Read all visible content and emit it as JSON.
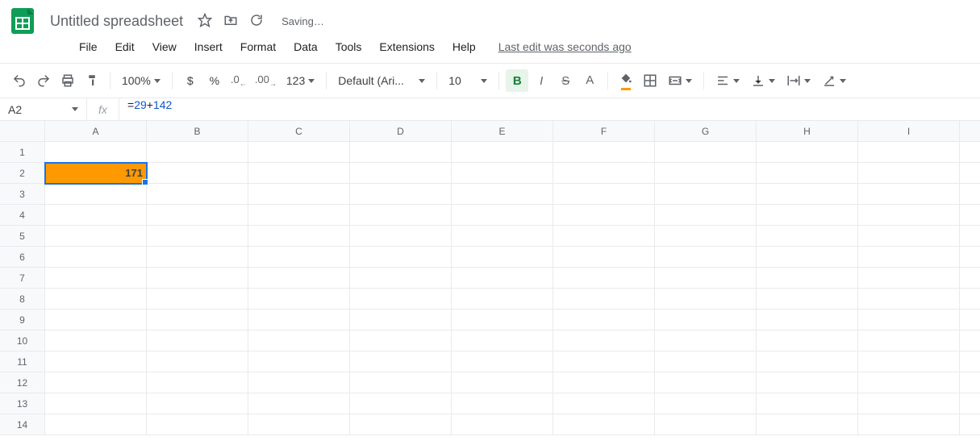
{
  "header": {
    "doc_title": "Untitled spreadsheet",
    "saving_label": "Saving…"
  },
  "menu": {
    "items": [
      "File",
      "Edit",
      "View",
      "Insert",
      "Format",
      "Data",
      "Tools",
      "Extensions",
      "Help"
    ],
    "last_edit": "Last edit was seconds ago"
  },
  "toolbar": {
    "zoom": "100%",
    "currency": "$",
    "percent": "%",
    "dec_dec": ".0",
    "inc_dec": ".00",
    "more_formats": "123",
    "font": "Default (Ari...",
    "font_size": "10",
    "bold": "B",
    "italic": "I",
    "strike": "S",
    "text_color": "A"
  },
  "formula": {
    "cell_ref": "A2",
    "expr_parts": {
      "a": "29",
      "op": "+",
      "b": "142"
    }
  },
  "grid": {
    "columns": [
      "A",
      "B",
      "C",
      "D",
      "E",
      "F",
      "G",
      "H",
      "I"
    ],
    "row_count": 14,
    "selected": "A2",
    "cells": {
      "A2": {
        "value": "171",
        "bold": true,
        "fill": "#ff9900",
        "align": "right"
      }
    }
  }
}
